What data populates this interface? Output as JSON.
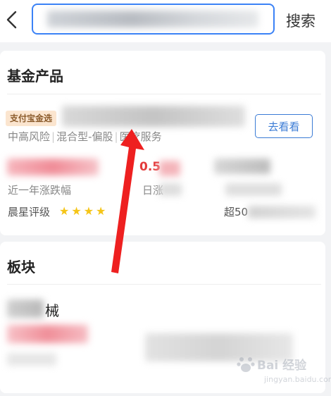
{
  "header": {
    "search_placeholder": "",
    "search_button_label": "搜索"
  },
  "fund_card": {
    "title": "基金产品",
    "tag": "支付宝金选",
    "meta": [
      "中高风险",
      "混合型-偏股",
      "医疗服务"
    ],
    "go_button_label": "去看看",
    "stat_value": "0.5",
    "stat_label_1": "近一年涨跌幅",
    "stat_label_2": "日涨",
    "rating_label": "晨星评级",
    "rating_stars": 4,
    "exceed_prefix": "超50"
  },
  "sector_card": {
    "title": "板块",
    "item_name": "械"
  },
  "watermark": {
    "brand": "Bai 经验",
    "url": "jingyan.baidu.com"
  },
  "colors": {
    "accent": "#3a7bd5",
    "rise": "#e33b3b",
    "star": "#f5c518",
    "arrow": "#ee2020"
  }
}
